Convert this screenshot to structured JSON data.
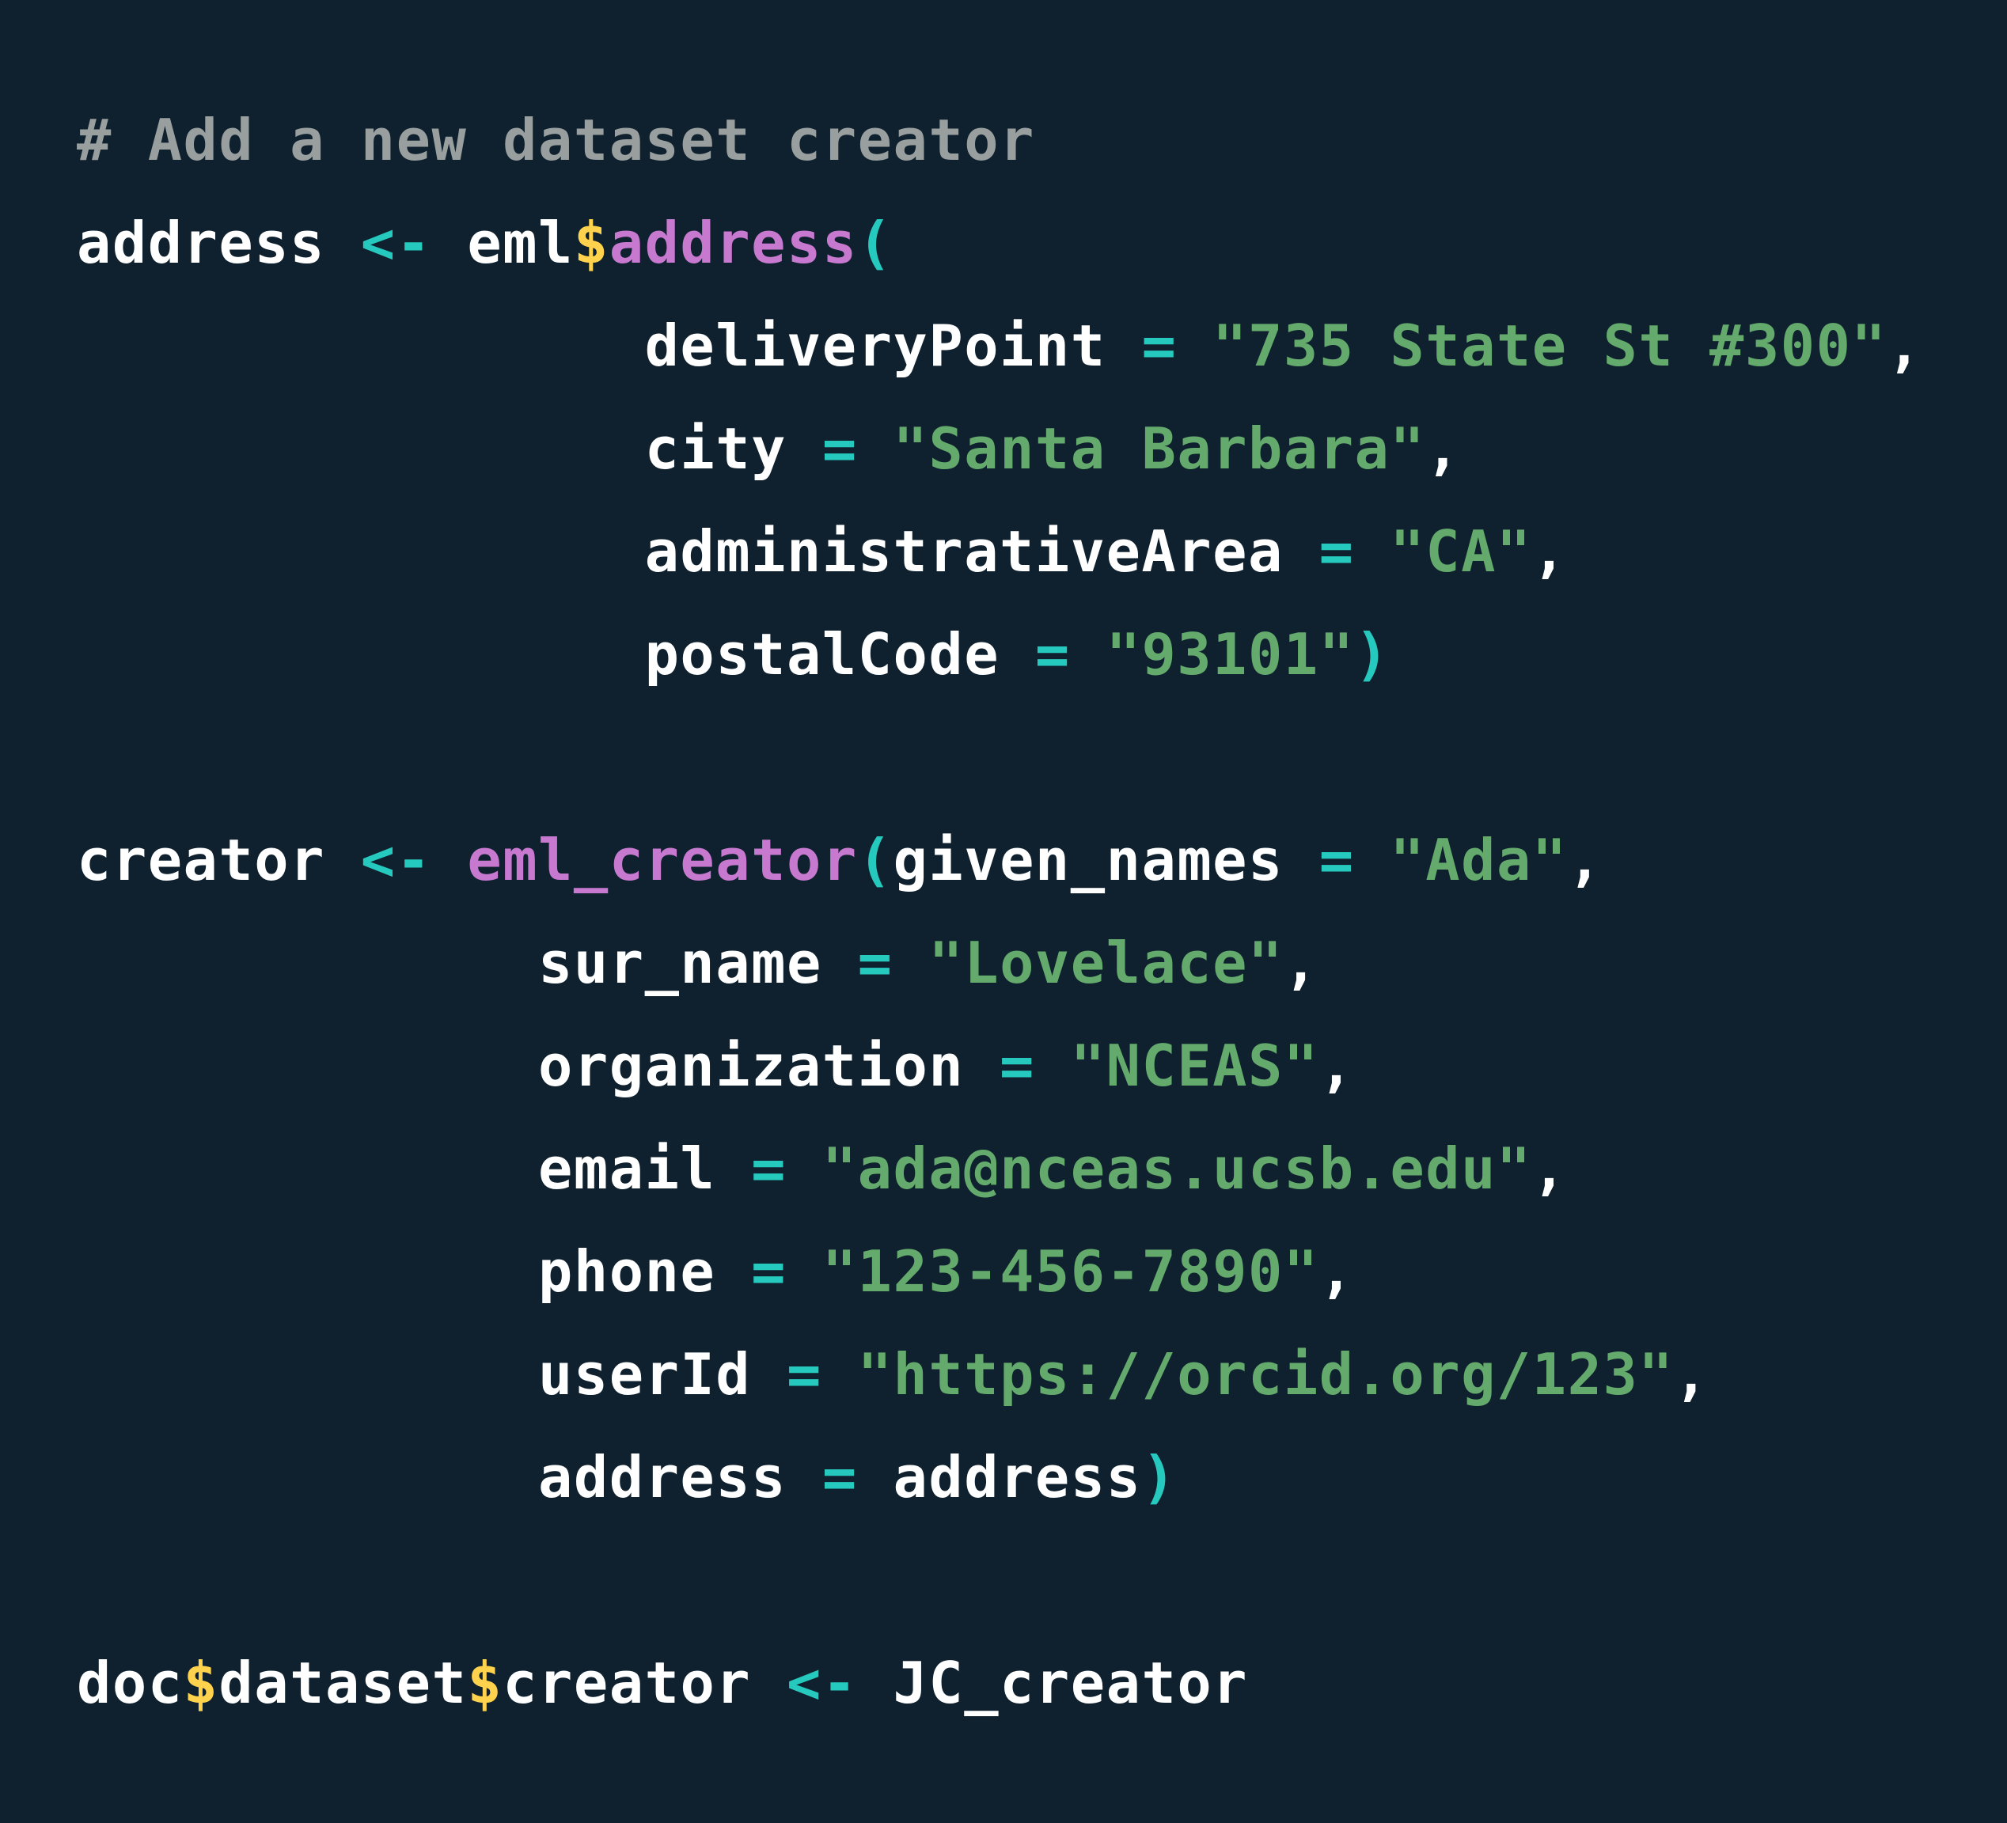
{
  "theme": {
    "background": "#0f212e",
    "comment": "#999f9e",
    "identifier": "#ffffff",
    "operator": "#26c9be",
    "function": "#c779d0",
    "dollar": "#ffd24d",
    "string": "#63aa6c"
  },
  "code": {
    "lines": [
      {
        "tokens": [
          {
            "t": "comment",
            "v": "# Add a new dataset creator"
          }
        ]
      },
      {
        "tokens": [
          {
            "t": "ident",
            "v": "address "
          },
          {
            "t": "op",
            "v": "<-"
          },
          {
            "t": "ident",
            "v": " eml"
          },
          {
            "t": "dollar",
            "v": "$"
          },
          {
            "t": "fn",
            "v": "address"
          },
          {
            "t": "op",
            "v": "("
          }
        ]
      },
      {
        "tokens": [
          {
            "t": "ident",
            "v": "                deliveryPoint "
          },
          {
            "t": "op",
            "v": "="
          },
          {
            "t": "ident",
            "v": " "
          },
          {
            "t": "string",
            "v": "\"735 State St #300\""
          },
          {
            "t": "punct",
            "v": ","
          }
        ]
      },
      {
        "tokens": [
          {
            "t": "ident",
            "v": "                city "
          },
          {
            "t": "op",
            "v": "="
          },
          {
            "t": "ident",
            "v": " "
          },
          {
            "t": "string",
            "v": "\"Santa Barbara\""
          },
          {
            "t": "punct",
            "v": ","
          }
        ]
      },
      {
        "tokens": [
          {
            "t": "ident",
            "v": "                administrativeArea "
          },
          {
            "t": "op",
            "v": "="
          },
          {
            "t": "ident",
            "v": " "
          },
          {
            "t": "string",
            "v": "\"CA\""
          },
          {
            "t": "punct",
            "v": ","
          }
        ]
      },
      {
        "tokens": [
          {
            "t": "ident",
            "v": "                postalCode "
          },
          {
            "t": "op",
            "v": "="
          },
          {
            "t": "ident",
            "v": " "
          },
          {
            "t": "string",
            "v": "\"93101\""
          },
          {
            "t": "op",
            "v": ")"
          }
        ]
      },
      {
        "tokens": []
      },
      {
        "tokens": [
          {
            "t": "ident",
            "v": "creator "
          },
          {
            "t": "op",
            "v": "<-"
          },
          {
            "t": "ident",
            "v": " "
          },
          {
            "t": "fn",
            "v": "eml_creator"
          },
          {
            "t": "op",
            "v": "("
          },
          {
            "t": "ident",
            "v": "given_names "
          },
          {
            "t": "op",
            "v": "="
          },
          {
            "t": "ident",
            "v": " "
          },
          {
            "t": "string",
            "v": "\"Ada\""
          },
          {
            "t": "punct",
            "v": ","
          }
        ]
      },
      {
        "tokens": [
          {
            "t": "ident",
            "v": "             sur_name "
          },
          {
            "t": "op",
            "v": "="
          },
          {
            "t": "ident",
            "v": " "
          },
          {
            "t": "string",
            "v": "\"Lovelace\""
          },
          {
            "t": "punct",
            "v": ","
          }
        ]
      },
      {
        "tokens": [
          {
            "t": "ident",
            "v": "             organization "
          },
          {
            "t": "op",
            "v": "="
          },
          {
            "t": "ident",
            "v": " "
          },
          {
            "t": "string",
            "v": "\"NCEAS\""
          },
          {
            "t": "punct",
            "v": ","
          }
        ]
      },
      {
        "tokens": [
          {
            "t": "ident",
            "v": "             email "
          },
          {
            "t": "op",
            "v": "="
          },
          {
            "t": "ident",
            "v": " "
          },
          {
            "t": "string",
            "v": "\"ada@nceas.ucsb.edu\""
          },
          {
            "t": "punct",
            "v": ","
          }
        ]
      },
      {
        "tokens": [
          {
            "t": "ident",
            "v": "             phone "
          },
          {
            "t": "op",
            "v": "="
          },
          {
            "t": "ident",
            "v": " "
          },
          {
            "t": "string",
            "v": "\"123-456-7890\""
          },
          {
            "t": "punct",
            "v": ","
          }
        ]
      },
      {
        "tokens": [
          {
            "t": "ident",
            "v": "             userId "
          },
          {
            "t": "op",
            "v": "="
          },
          {
            "t": "ident",
            "v": " "
          },
          {
            "t": "string",
            "v": "\"https://orcid.org/123\""
          },
          {
            "t": "punct",
            "v": ","
          }
        ]
      },
      {
        "tokens": [
          {
            "t": "ident",
            "v": "             address "
          },
          {
            "t": "op",
            "v": "="
          },
          {
            "t": "ident",
            "v": " address"
          },
          {
            "t": "op",
            "v": ")"
          }
        ]
      },
      {
        "tokens": []
      },
      {
        "tokens": [
          {
            "t": "ident",
            "v": "doc"
          },
          {
            "t": "dollar",
            "v": "$"
          },
          {
            "t": "ident",
            "v": "dataset"
          },
          {
            "t": "dollar",
            "v": "$"
          },
          {
            "t": "ident",
            "v": "creator "
          },
          {
            "t": "op",
            "v": "<-"
          },
          {
            "t": "ident",
            "v": " JC_creator"
          }
        ]
      }
    ]
  }
}
